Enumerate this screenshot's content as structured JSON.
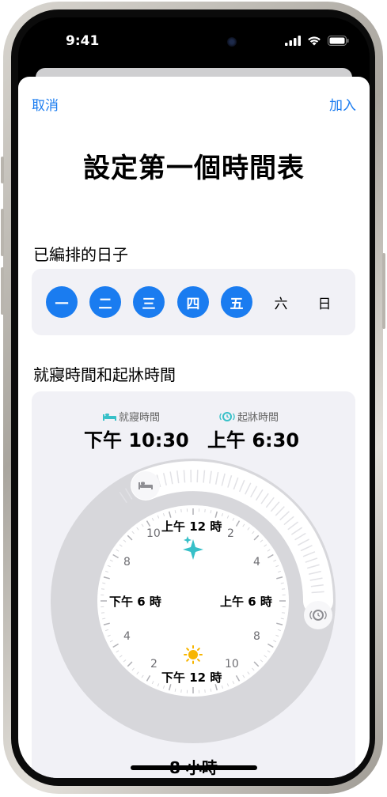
{
  "status": {
    "time": "9:41"
  },
  "nav": {
    "cancel": "取消",
    "add": "加入"
  },
  "title": "設定第一個時間表",
  "days_section": {
    "label": "已編排的日子",
    "days": [
      {
        "label": "一",
        "selected": true
      },
      {
        "label": "二",
        "selected": true
      },
      {
        "label": "三",
        "selected": true
      },
      {
        "label": "四",
        "selected": true
      },
      {
        "label": "五",
        "selected": true
      },
      {
        "label": "六",
        "selected": false
      },
      {
        "label": "日",
        "selected": false
      }
    ]
  },
  "schedule_section": {
    "label": "就寢時間和起牀時間",
    "bedtime": {
      "label": "就寢時間",
      "value": "下午 10:30"
    },
    "wake": {
      "label": "起牀時間",
      "value": "上午 6:30"
    },
    "clock": {
      "top": "上午 12 時",
      "right": "上午 6 時",
      "bottom": "下午 12 時",
      "left": "下午 6 時",
      "ticks": [
        "2",
        "4",
        "8",
        "10",
        "2",
        "4",
        "8",
        "10"
      ]
    },
    "duration": "8 小時"
  },
  "colors": {
    "accent": "#1a7cf0",
    "card": "#f1f1f6",
    "bed_icon": "#37c0c8",
    "alarm_icon": "#37c0c8",
    "sun": "#f7b500"
  },
  "icons": {
    "bed": "bed-icon",
    "alarm": "alarm-clock-icon",
    "sparkle": "sparkle-icon",
    "sun": "sun-icon"
  }
}
